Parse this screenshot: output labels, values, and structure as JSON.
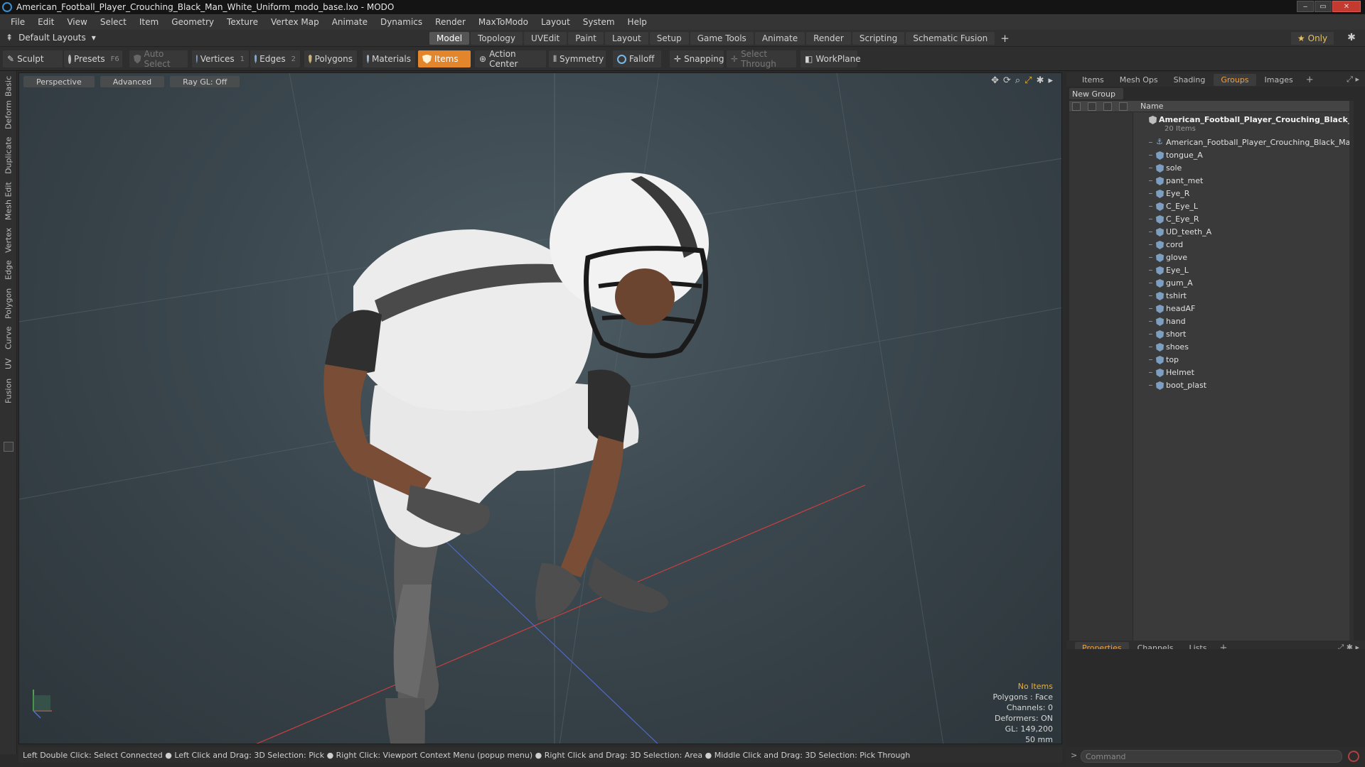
{
  "window": {
    "title": "American_Football_Player_Crouching_Black_Man_White_Uniform_modo_base.lxo - MODO",
    "min": "‒",
    "max": "▭",
    "close": "✕"
  },
  "menu": [
    "File",
    "Edit",
    "View",
    "Select",
    "Item",
    "Geometry",
    "Texture",
    "Vertex Map",
    "Animate",
    "Dynamics",
    "Render",
    "MaxToModo",
    "Layout",
    "System",
    "Help"
  ],
  "layout_bar": {
    "default_layouts": "Default Layouts",
    "tabs": [
      "Model",
      "Topology",
      "UVEdit",
      "Paint",
      "Layout",
      "Setup",
      "Game Tools",
      "Animate",
      "Render",
      "Scripting",
      "Schematic Fusion"
    ],
    "active_tab": "Model",
    "plus": "+",
    "only_label": "Only",
    "star": "★",
    "gear": "✱"
  },
  "toolbar": {
    "sculpt": "Sculpt",
    "presets": "Presets",
    "presets_key": "F6",
    "auto_select": "Auto Select",
    "vertices": "Vertices",
    "vertices_key": "1",
    "edges": "Edges",
    "edges_key": "2",
    "polygons": "Polygons",
    "materials": "Materials",
    "items": "Items",
    "action_center": "Action Center",
    "symmetry": "Symmetry",
    "falloff": "Falloff",
    "snapping": "Snapping",
    "select_through": "Select Through",
    "workplane": "WorkPlane"
  },
  "left_tabs": [
    "Basic",
    "Deform",
    "Duplicate",
    "Mesh Edit",
    "Vertex",
    "Edge",
    "Polygon",
    "Curve",
    "UV",
    "Fusion"
  ],
  "viewport": {
    "view": "Perspective",
    "shading": "Advanced",
    "raygl": "Ray GL: Off",
    "info": {
      "items": "No Items",
      "polygons": "Polygons : Face",
      "channels": "Channels: 0",
      "deformers": "Deformers: ON",
      "gl": "GL: 149,200",
      "scale": "50 mm"
    }
  },
  "status_bar": "Left Double Click: Select Connected ● Left Click and Drag: 3D Selection: Pick ● Right Click: Viewport Context Menu (popup menu) ● Right Click and Drag: 3D Selection: Area ● Middle Click and Drag: 3D Selection: Pick Through",
  "top_panel": {
    "tabs": [
      "Items",
      "Mesh Ops",
      "Shading",
      "Groups",
      "Images"
    ],
    "active": "Groups",
    "plus": "+",
    "new_group": "New Group",
    "name_header": "Name",
    "group_name": "American_Football_Player_Crouching_Black_ ...",
    "group_count": "20 Items",
    "first_item": "American_Football_Player_Crouching_Black_Man_ ...",
    "items": [
      "tongue_A",
      "sole",
      "pant_met",
      "Eye_R",
      "C_Eye_L",
      "C_Eye_R",
      "UD_teeth_A",
      "cord",
      "glove",
      "Eye_L",
      "gum_A",
      "tshirt",
      "headAF",
      "hand",
      "short",
      "shoes",
      "top",
      "Helmet",
      "boot_plast"
    ]
  },
  "bottom_panel": {
    "tabs": [
      "Properties",
      "Channels",
      "Lists"
    ],
    "active": "Properties",
    "plus": "+"
  },
  "command": {
    "placeholder": "Command",
    "arrow": ">"
  }
}
